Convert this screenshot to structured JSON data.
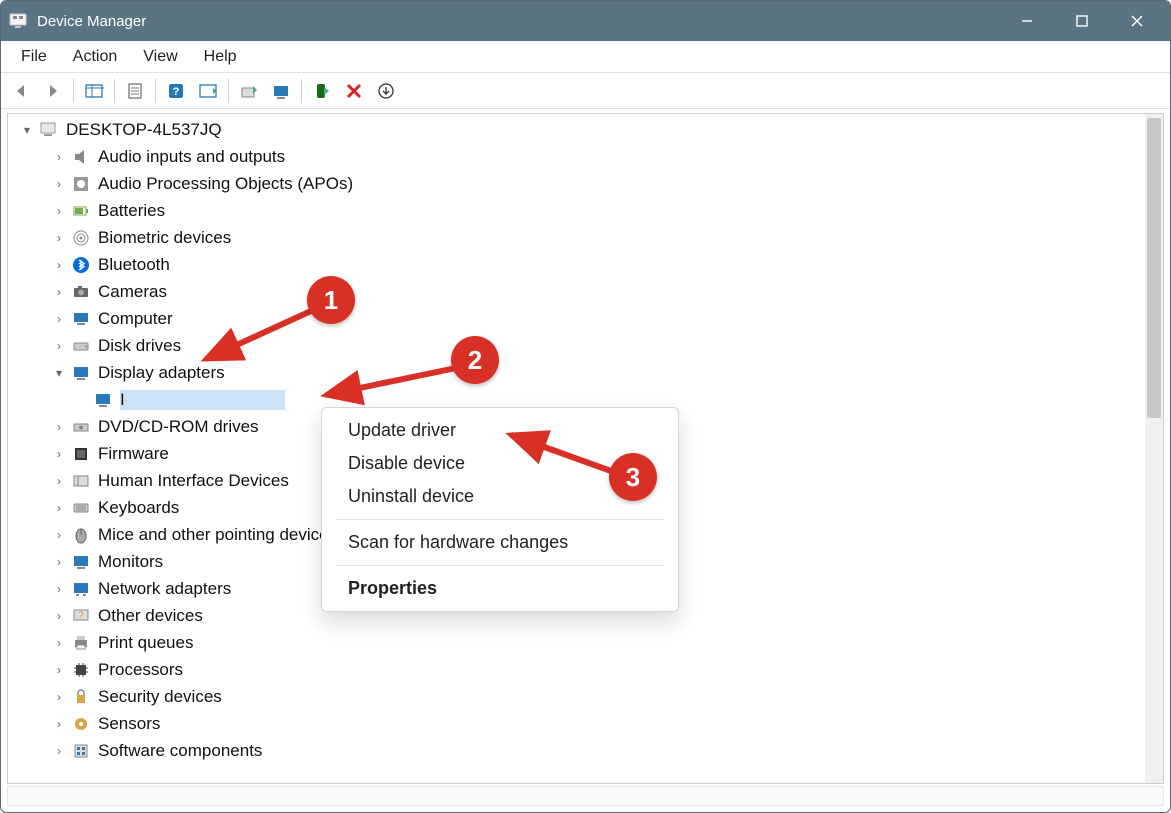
{
  "window": {
    "title": "Device Manager"
  },
  "menubar": [
    "File",
    "Action",
    "View",
    "Help"
  ],
  "tree": {
    "root": "DESKTOP-4L537JQ",
    "categories": [
      "Audio inputs and outputs",
      "Audio Processing Objects (APOs)",
      "Batteries",
      "Biometric devices",
      "Bluetooth",
      "Cameras",
      "Computer",
      "Disk drives",
      "Display adapters",
      "DVD/CD-ROM drives",
      "Firmware",
      "Human Interface Devices",
      "Keyboards",
      "Mice and other pointing devices",
      "Monitors",
      "Network adapters",
      "Other devices",
      "Print queues",
      "Processors",
      "Security devices",
      "Sensors",
      "Software components"
    ],
    "expanded_category_index": 8,
    "selected_device": "I"
  },
  "context_menu": {
    "items": [
      "Update driver",
      "Disable device",
      "Uninstall device",
      "Scan for hardware changes",
      "Properties"
    ]
  },
  "annotations": {
    "markers": [
      "1",
      "2",
      "3"
    ]
  },
  "colors": {
    "titlebar": "#5b7481",
    "marker": "#d93025",
    "selection": "#cde3f8"
  }
}
